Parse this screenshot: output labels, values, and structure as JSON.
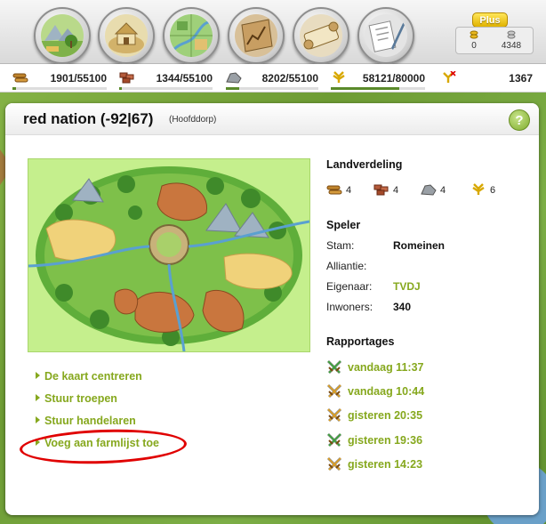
{
  "topnav": {
    "buttons": [
      {
        "name": "resource-fields-button",
        "icon": "resource-fields-icon"
      },
      {
        "name": "village-center-button",
        "icon": "village-icon"
      },
      {
        "name": "map-button",
        "icon": "map-icon"
      },
      {
        "name": "statistics-button",
        "icon": "statistics-icon"
      },
      {
        "name": "reports-button",
        "icon": "reports-icon"
      },
      {
        "name": "messages-button",
        "icon": "messages-icon"
      }
    ],
    "plus_label": "Plus",
    "gold_value": "0",
    "silver_value": "4348"
  },
  "resources": {
    "wood": {
      "value": "1901/55100",
      "fill": 0.034
    },
    "clay": {
      "value": "1344/55100",
      "fill": 0.024
    },
    "iron": {
      "value": "8202/55100",
      "fill": 0.149
    },
    "crop": {
      "value": "58121/80000",
      "fill": 0.727
    },
    "crop_consumption": "1367"
  },
  "panel": {
    "title": "red nation (-92|67)",
    "subtitle": "(Hoofddorp)",
    "help_label": "?",
    "links": [
      "De kaart centreren",
      "Stuur troepen",
      "Stuur handelaren",
      "Voeg aan farmlijst toe"
    ],
    "landverdeling": {
      "title": "Landverdeling",
      "wood": "4",
      "clay": "4",
      "iron": "4",
      "crop": "6"
    },
    "speler": {
      "title": "Speler",
      "rows": [
        {
          "label": "Stam:",
          "value": "Romeinen"
        },
        {
          "label": "Alliantie:",
          "value": ""
        },
        {
          "label": "Eigenaar:",
          "value": "TVDJ"
        },
        {
          "label": "Inwoners:",
          "value": "340"
        }
      ]
    },
    "rapportages": {
      "title": "Rapportages",
      "items": [
        {
          "time": "vandaag 11:37",
          "color": "#3aa33a"
        },
        {
          "time": "vandaag 10:44",
          "color": "#e0a020"
        },
        {
          "time": "gisteren 20:35",
          "color": "#e0a020"
        },
        {
          "time": "gisteren 19:36",
          "color": "#3aa33a"
        },
        {
          "time": "gisteren 14:23",
          "color": "#e0a020"
        }
      ]
    }
  },
  "colors": {
    "link": "#86a81e",
    "highlight_circle": "#e00000"
  }
}
